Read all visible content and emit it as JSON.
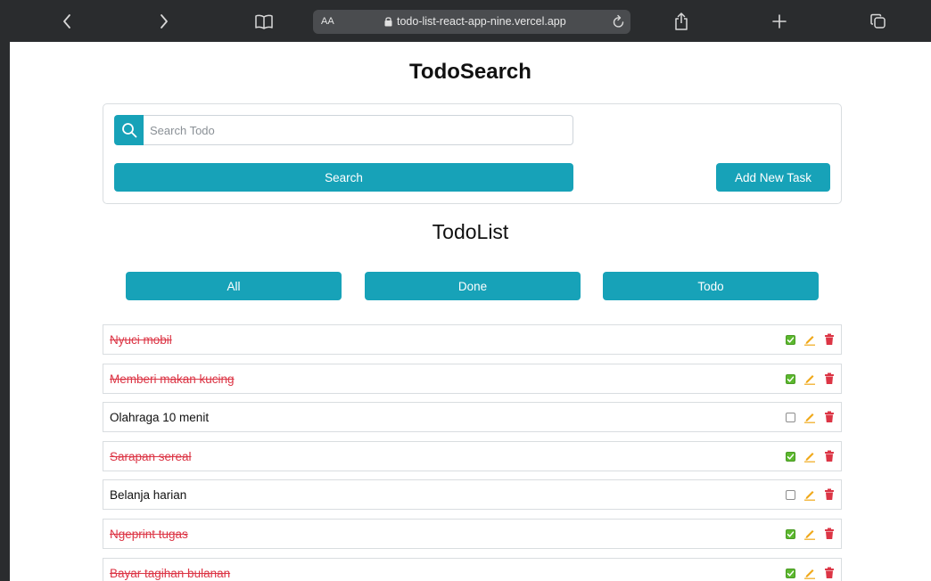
{
  "browser": {
    "url": "todo-list-react-app-nine.vercel.app",
    "aa_label": "AA",
    "icons": [
      "back-icon",
      "forward-icon",
      "bookmarks-icon",
      "lock-icon",
      "reload-icon",
      "share-icon",
      "new-tab-icon",
      "tabs-icon"
    ]
  },
  "search": {
    "title": "TodoSearch",
    "placeholder": "Search Todo",
    "value": "",
    "search_label": "Search",
    "add_label": "Add New Task"
  },
  "list": {
    "title": "TodoList",
    "filters": [
      {
        "label": "All"
      },
      {
        "label": "Done"
      },
      {
        "label": "Todo"
      }
    ],
    "items": [
      {
        "text": "Nyuci mobil",
        "done": true
      },
      {
        "text": "Memberi makan kucing",
        "done": true
      },
      {
        "text": "Olahraga 10 menit",
        "done": false
      },
      {
        "text": "Sarapan sereal",
        "done": true
      },
      {
        "text": "Belanja harian",
        "done": false
      },
      {
        "text": "Ngeprint tugas",
        "done": true
      },
      {
        "text": "Bayar tagihan bulanan",
        "done": true
      }
    ]
  },
  "colors": {
    "accent": "#17a2b8",
    "done_text": "#dc3545",
    "edit_icon": "#f0a818",
    "trash_icon": "#dc3545",
    "checkbox_on": "#5cb82e"
  }
}
